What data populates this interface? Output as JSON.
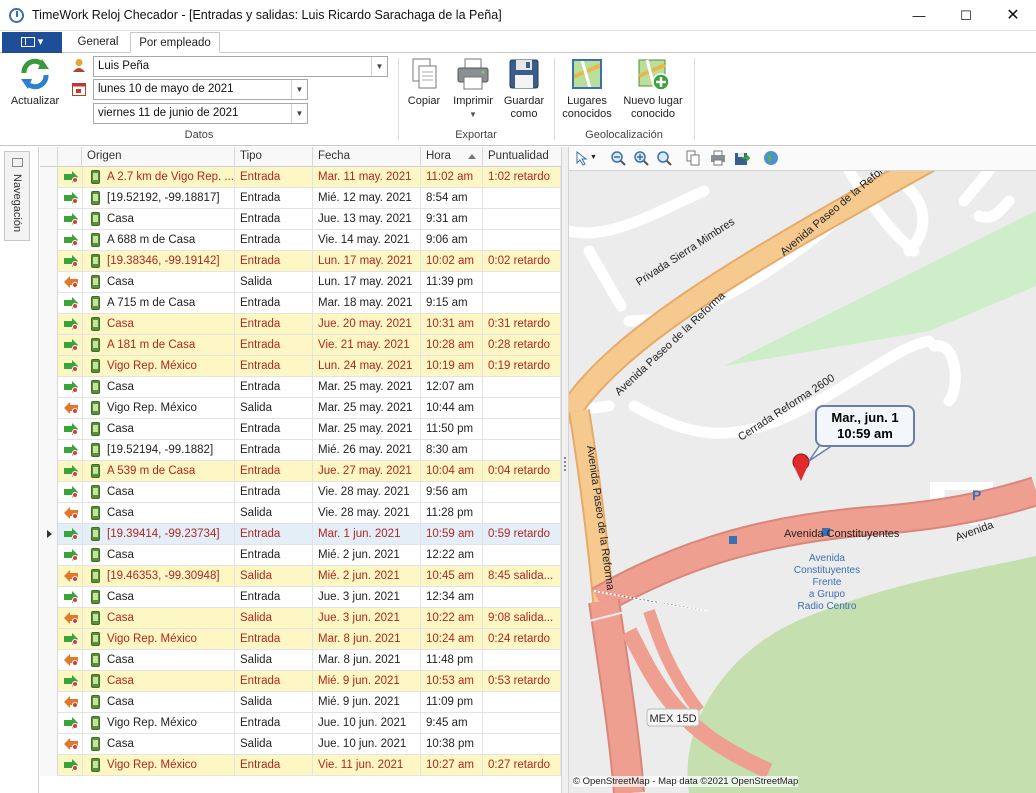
{
  "window": {
    "title": "TimeWork Reloj Checador - [Entradas y salidas: Luis Ricardo Sarachaga de la Peña]"
  },
  "ribbon": {
    "tabs": [
      {
        "label": "General"
      },
      {
        "label": "Por empleado"
      }
    ],
    "refresh_label": "Actualizar",
    "employee_value": "Luis Peña",
    "date_from": "lunes 10 de mayo de 2021",
    "date_to": "viernes 11 de junio de 2021",
    "group_datos": "Datos",
    "copy_label": "Copiar",
    "print_label": "Imprimir",
    "save_label": "Guardar como",
    "group_exportar": "Exportar",
    "places_label": "Lugares conocidos",
    "new_place_label": "Nuevo lugar conocido",
    "group_geo": "Geolocalización"
  },
  "navigation": {
    "label": "Navegación"
  },
  "grid": {
    "columns": [
      "Origen",
      "Tipo",
      "Fecha",
      "Hora",
      "Puntualidad"
    ],
    "rows": [
      {
        "origen": "A 2.7 km de Vigo Rep. ...",
        "tipo": "Entrada",
        "fecha": "Mar. 11 may. 2021",
        "hora": "11:02 am",
        "puntualidad": "1:02 retardo",
        "late": true
      },
      {
        "origen": "[19.52192, -99.18817]",
        "tipo": "Entrada",
        "fecha": "Mié. 12 may. 2021",
        "hora": "8:54 am",
        "puntualidad": "",
        "late": false
      },
      {
        "origen": "Casa",
        "tipo": "Entrada",
        "fecha": "Jue. 13 may. 2021",
        "hora": "9:31 am",
        "puntualidad": "",
        "late": false
      },
      {
        "origen": "A 688 m de Casa",
        "tipo": "Entrada",
        "fecha": "Vie. 14 may. 2021",
        "hora": "9:06 am",
        "puntualidad": "",
        "late": false
      },
      {
        "origen": "[19.38346, -99.19142]",
        "tipo": "Entrada",
        "fecha": "Lun. 17 may. 2021",
        "hora": "10:02 am",
        "puntualidad": "0:02 retardo",
        "late": true
      },
      {
        "origen": "Casa",
        "tipo": "Salida",
        "fecha": "Lun. 17 may. 2021",
        "hora": "11:39 pm",
        "puntualidad": "",
        "late": false
      },
      {
        "origen": "A 715 m de Casa",
        "tipo": "Entrada",
        "fecha": "Mar. 18 may. 2021",
        "hora": "9:15 am",
        "puntualidad": "",
        "late": false
      },
      {
        "origen": "Casa",
        "tipo": "Entrada",
        "fecha": "Jue. 20 may. 2021",
        "hora": "10:31 am",
        "puntualidad": "0:31 retardo",
        "late": true
      },
      {
        "origen": "A 181 m de Casa",
        "tipo": "Entrada",
        "fecha": "Vie. 21 may. 2021",
        "hora": "10:28 am",
        "puntualidad": "0:28 retardo",
        "late": true
      },
      {
        "origen": "Vigo Rep. México",
        "tipo": "Entrada",
        "fecha": "Lun. 24 may. 2021",
        "hora": "10:19 am",
        "puntualidad": "0:19 retardo",
        "late": true
      },
      {
        "origen": "Casa",
        "tipo": "Entrada",
        "fecha": "Mar. 25 may. 2021",
        "hora": "12:07 am",
        "puntualidad": "",
        "late": false
      },
      {
        "origen": "Vigo Rep. México",
        "tipo": "Salida",
        "fecha": "Mar. 25 may. 2021",
        "hora": "10:44 am",
        "puntualidad": "",
        "late": false
      },
      {
        "origen": "Casa",
        "tipo": "Entrada",
        "fecha": "Mar. 25 may. 2021",
        "hora": "11:50 pm",
        "puntualidad": "",
        "late": false
      },
      {
        "origen": "[19.52194, -99.1882]",
        "tipo": "Entrada",
        "fecha": "Mié. 26 may. 2021",
        "hora": "8:30 am",
        "puntualidad": "",
        "late": false
      },
      {
        "origen": "A 539 m de Casa",
        "tipo": "Entrada",
        "fecha": "Jue. 27 may. 2021",
        "hora": "10:04 am",
        "puntualidad": "0:04 retardo",
        "late": true
      },
      {
        "origen": "Casa",
        "tipo": "Entrada",
        "fecha": "Vie. 28 may. 2021",
        "hora": "9:56 am",
        "puntualidad": "",
        "late": false
      },
      {
        "origen": "Casa",
        "tipo": "Salida",
        "fecha": "Vie. 28 may. 2021",
        "hora": "11:28 pm",
        "puntualidad": "",
        "late": false
      },
      {
        "origen": "[19.39414, -99.23734]",
        "tipo": "Entrada",
        "fecha": "Mar. 1 jun. 2021",
        "hora": "10:59 am",
        "puntualidad": "0:59 retardo",
        "late": true,
        "current": true
      },
      {
        "origen": "Casa",
        "tipo": "Entrada",
        "fecha": "Mié. 2 jun. 2021",
        "hora": "12:22 am",
        "puntualidad": "",
        "late": false
      },
      {
        "origen": "[19.46353, -99.30948]",
        "tipo": "Salida",
        "fecha": "Mié. 2 jun. 2021",
        "hora": "10:45 am",
        "puntualidad": "8:45 salida...",
        "late": true
      },
      {
        "origen": "Casa",
        "tipo": "Entrada",
        "fecha": "Jue. 3 jun. 2021",
        "hora": "12:34 am",
        "puntualidad": "",
        "late": false
      },
      {
        "origen": "Casa",
        "tipo": "Salida",
        "fecha": "Jue. 3 jun. 2021",
        "hora": "10:22 am",
        "puntualidad": "9:08 salida...",
        "late": true
      },
      {
        "origen": "Vigo Rep. México",
        "tipo": "Entrada",
        "fecha": "Mar. 8 jun. 2021",
        "hora": "10:24 am",
        "puntualidad": "0:24 retardo",
        "late": true
      },
      {
        "origen": "Casa",
        "tipo": "Salida",
        "fecha": "Mar. 8 jun. 2021",
        "hora": "11:48 pm",
        "puntualidad": "",
        "late": false
      },
      {
        "origen": "Casa",
        "tipo": "Entrada",
        "fecha": "Mié. 9 jun. 2021",
        "hora": "10:53 am",
        "puntualidad": "0:53 retardo",
        "late": true
      },
      {
        "origen": "Casa",
        "tipo": "Salida",
        "fecha": "Mié. 9 jun. 2021",
        "hora": "11:09 pm",
        "puntualidad": "",
        "late": false
      },
      {
        "origen": "Vigo Rep. México",
        "tipo": "Entrada",
        "fecha": "Jue. 10 jun. 2021",
        "hora": "9:45 am",
        "puntualidad": "",
        "late": false
      },
      {
        "origen": "Casa",
        "tipo": "Salida",
        "fecha": "Jue. 10 jun. 2021",
        "hora": "10:38 pm",
        "puntualidad": "",
        "late": false
      },
      {
        "origen": "Vigo Rep. México",
        "tipo": "Entrada",
        "fecha": "Vie. 11 jun. 2021",
        "hora": "10:27 am",
        "puntualidad": "0:27 retardo",
        "late": true
      }
    ]
  },
  "map": {
    "callout_line1": "Mar., jun. 1",
    "callout_line2": "10:59 am",
    "streets": {
      "paseo1": "Avenida Paseo de la Reforma",
      "paseo2": "Avenida Paseo de la Reforma",
      "paseo3": "Avenida Paseo de la Reforma",
      "sierra": "Privada Sierra Mimbres",
      "cerrada": "Cerrada Reforma 2600",
      "constituyentes1": "Avenida Constituyentes",
      "constituyentes2": "Avenida",
      "stop1": "Avenida",
      "stop2": "Constituyentes",
      "stop3": "Frente",
      "stop4": "a Grupo",
      "stop5": "Radio Centro",
      "mex": "MEX 15D",
      "parking": "P"
    },
    "attribution": "© OpenStreetMap - Map data ©2021 OpenStreetMap"
  },
  "colors": {
    "accent": "#1f4e99",
    "late_row": "#fdf7c3",
    "late_text": "#b3261e",
    "road_orange": "#f6c98e",
    "road_red": "#ee9f90",
    "park_green": "#c5dfae"
  }
}
